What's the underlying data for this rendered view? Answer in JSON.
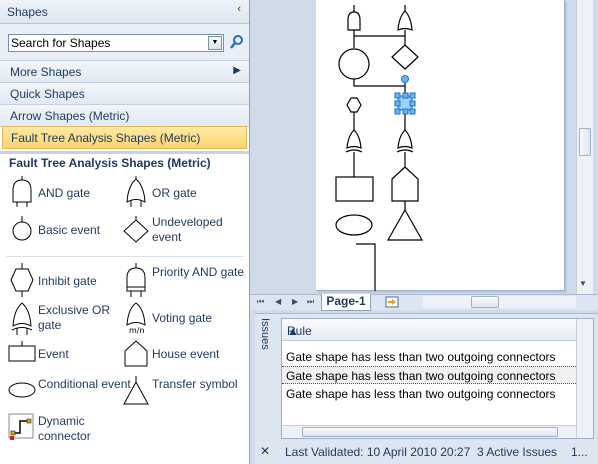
{
  "shapes_pane": {
    "title": "Shapes",
    "collapse_glyph": "‹",
    "search": {
      "value": "Search for Shapes",
      "placeholder": "Search for Shapes"
    },
    "categories": [
      {
        "label": "More Shapes",
        "has_arrow": true
      },
      {
        "label": "Quick Shapes"
      },
      {
        "label": "Arrow Shapes (Metric)"
      },
      {
        "label": "Fault Tree Analysis Shapes (Metric)",
        "active": true
      }
    ],
    "stencil_title": "Fault Tree Analysis Shapes (Metric)",
    "masters": [
      {
        "name": "AND gate",
        "icon": "and-gate-icon"
      },
      {
        "name": "OR gate",
        "icon": "or-gate-icon"
      },
      {
        "name": "Basic event",
        "icon": "circle-icon"
      },
      {
        "name": "Undeveloped event",
        "icon": "diamond-icon"
      },
      {
        "name": "Inhibit gate",
        "icon": "hexagon-icon"
      },
      {
        "name": "Priority AND gate",
        "icon": "priority-and-gate-icon"
      },
      {
        "name": "Exclusive OR gate",
        "icon": "exclusive-or-gate-icon"
      },
      {
        "name": "Voting gate",
        "icon": "voting-gate-icon"
      },
      {
        "name": "Event",
        "icon": "rectangle-icon"
      },
      {
        "name": "House event",
        "icon": "house-icon"
      },
      {
        "name": "Conditional event",
        "icon": "ellipse-icon"
      },
      {
        "name": "Transfer symbol",
        "icon": "triangle-icon"
      },
      {
        "name": "Dynamic connector",
        "icon": "dynamic-connector-icon"
      }
    ]
  },
  "page_tabs": {
    "active": "Page-1"
  },
  "issues": {
    "vertical_label": "Issues",
    "column": "Rule",
    "rows": [
      "Gate shape has less than two outgoing connectors",
      "Gate shape has less than two outgoing connectors",
      "Gate shape has less than two outgoing connectors"
    ],
    "selected_row": 1,
    "status": {
      "last_validated": "Last Validated: 10 April 2010 20:27",
      "active_issues": "3 Active Issues",
      "tail": "1..."
    },
    "close_glyph": "✕"
  },
  "colors": {
    "accent": "#fcd571",
    "selection": "#2f7ed8",
    "pane_bg": "#cfdbe9"
  }
}
